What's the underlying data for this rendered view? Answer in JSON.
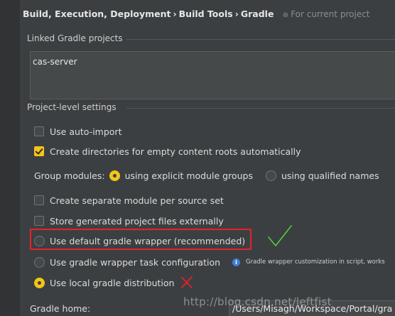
{
  "breadcrumb": {
    "items": [
      "Build, Execution, Deployment",
      "Build Tools",
      "Gradle"
    ],
    "separator": "›",
    "scope_text": "For current project",
    "scope_icon": "project-scope-icon"
  },
  "linked_projects": {
    "title": "Linked Gradle projects",
    "items": [
      "cas-server"
    ]
  },
  "project_settings": {
    "title": "Project-level settings",
    "use_auto_import": {
      "label": "Use auto-import",
      "checked": false
    },
    "create_dirs": {
      "label": "Create directories for empty content roots automatically",
      "checked": true
    },
    "group_modules": {
      "label": "Group modules:",
      "option_explicit": "using explicit module groups",
      "option_qualified": "using qualified names",
      "selected": "explicit"
    },
    "separate_module": {
      "label": "Create separate module per source set",
      "checked": false
    },
    "store_external": {
      "label": "Store generated project files externally",
      "checked": false
    },
    "wrapper_default": {
      "label": "Use default gradle wrapper (recommended)",
      "selected": false
    },
    "wrapper_task": {
      "label": "Use gradle wrapper task configuration",
      "selected": false
    },
    "wrapper_hint": "Gradle wrapper customization in script, works",
    "local_distribution": {
      "label": "Use local gradle distribution",
      "selected": true
    },
    "gradle_home_label": "Gradle home:",
    "gradle_home_value": "/Users/Misagh/Workspace/Portal/gra"
  },
  "watermark": "http://blog.csdn.net/leftfist",
  "colors": {
    "accent": "#f3c517",
    "annotation_red": "#e3232b",
    "annotation_green": "#4cd13a",
    "background": "#3c3f41"
  }
}
